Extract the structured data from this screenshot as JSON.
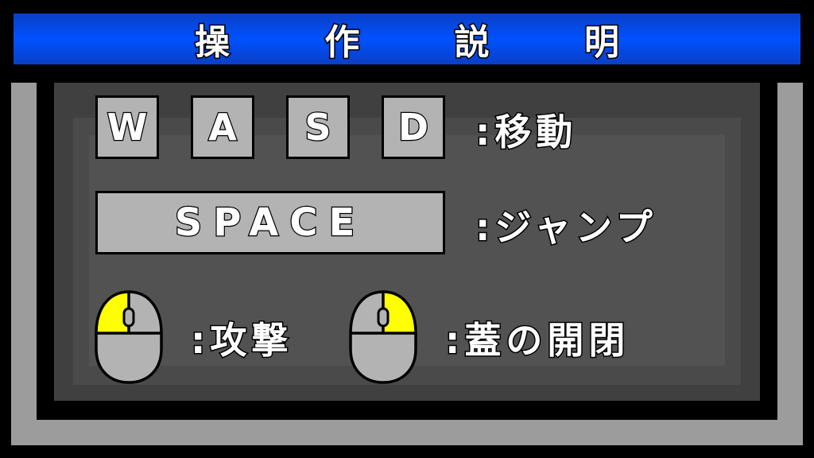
{
  "title": "操 作 説 明",
  "keys": {
    "w": "W",
    "a": "A",
    "s": "S",
    "d": "D",
    "space": "SPACE"
  },
  "labels": {
    "move": ":移動",
    "jump": ":ジャンプ",
    "attack": ":攻撃",
    "lid": ":蓋の開閉"
  },
  "icons": {
    "mouse_left": "mouse-left-click-icon",
    "mouse_right": "mouse-right-click-icon"
  },
  "colors": {
    "title_blue": "#0051ff",
    "key_fill": "#b3b3b3",
    "mouse_highlight": "#ffff00",
    "frame_gray": "#9c9c9c"
  }
}
